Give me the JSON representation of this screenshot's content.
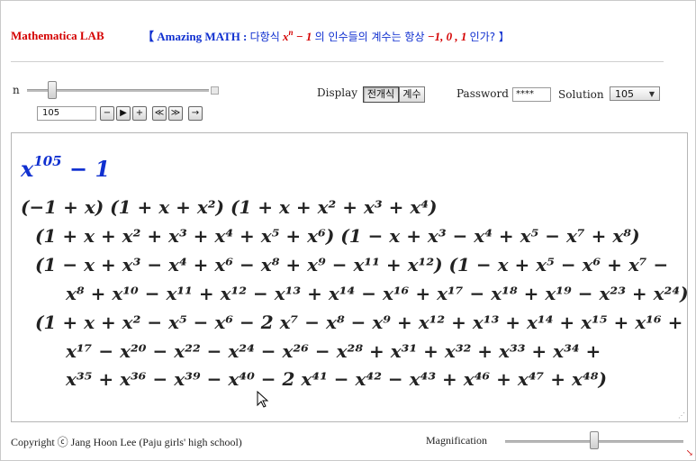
{
  "header": {
    "app_name": "Mathematica LAB",
    "title_open": "【 Amazing MATH :",
    "title_ko1": "다항식",
    "title_poly_base": "x",
    "title_poly_exp": "n",
    "title_poly_rest": "− 1",
    "title_ko2": "의 인수들의 계수는 항상",
    "title_values": "−1, 0 , 1",
    "title_ko3": "인가? 】"
  },
  "controls": {
    "n_label": "n",
    "n_value": "105",
    "n_fraction": 0.1,
    "buttons": {
      "minus": "−",
      "play": "▶",
      "plus": "+",
      "faster": "≪",
      "slower": "≫",
      "step": "→"
    },
    "display_label": "Display",
    "display_options": [
      "전개식",
      "계수"
    ],
    "display_selected": "전개식",
    "password_label": "Password",
    "password_value": "****",
    "solution_label": "Solution",
    "solution_value": "105"
  },
  "output": {
    "title_base": "x",
    "title_exp": "105",
    "title_rest": "− 1",
    "lines": [
      "(−1 + x) (1 + x + x²) (1 + x + x² + x³ + x⁴)",
      "(1 + x + x² + x³ + x⁴ + x⁵ + x⁶) (1 − x + x³ − x⁴ + x⁵ − x⁷ + x⁸)",
      "(1 − x + x³ − x⁴ + x⁶ − x⁸ + x⁹ − x¹¹ + x¹²) (1 − x + x⁵ − x⁶ + x⁷ −",
      "x⁸ + x¹⁰ − x¹¹ + x¹² − x¹³ + x¹⁴ − x¹⁶ + x¹⁷ − x¹⁸ + x¹⁹ − x²³ + x²⁴)",
      "(1 + x + x² − x⁵ − x⁶ − 2 x⁷ − x⁸ − x⁹ + x¹² + x¹³ + x¹⁴ + x¹⁵ + x¹⁶ +",
      "x¹⁷ − x²⁰ − x²² − x²⁴ − x²⁶ − x²⁸ + x³¹ + x³² + x³³ + x³⁴ +",
      "x³⁵ + x³⁶ − x³⁹ − x⁴⁰ − 2 x⁴¹ − x⁴² − x⁴³ + x⁴⁶ + x⁴⁷ + x⁴⁸)"
    ]
  },
  "footer": {
    "copyright": "Copyright ⓒ Jang Hoon Lee (Paju girls' high school)",
    "magnification_label": "Magnification",
    "magnification_fraction": 0.5
  },
  "colors": {
    "accent_red": "#d40000",
    "accent_blue": "#1030d0"
  }
}
